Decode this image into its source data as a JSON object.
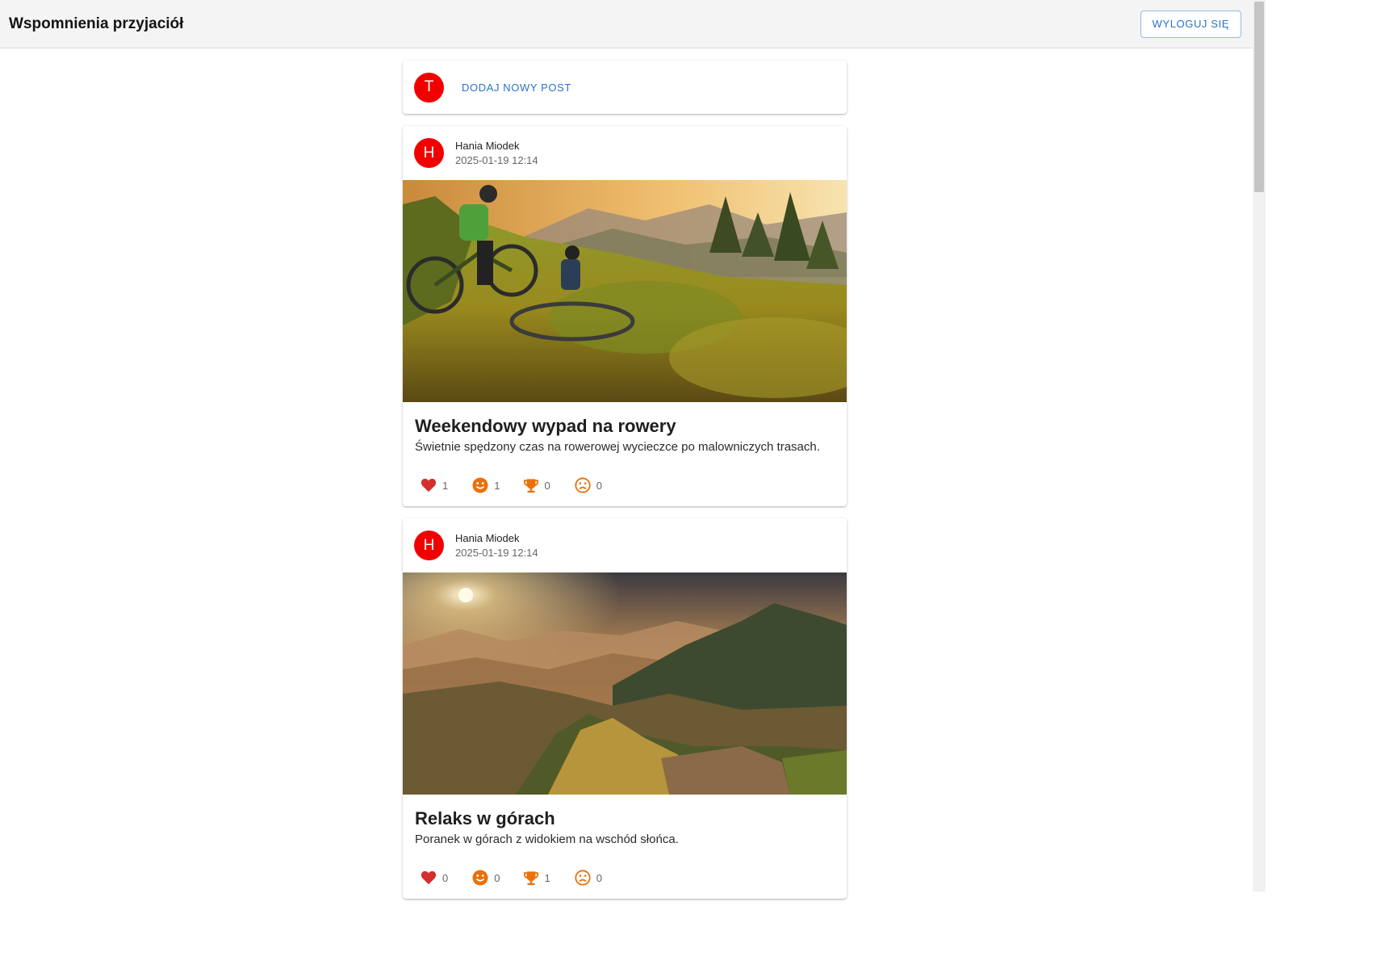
{
  "app": {
    "title": "Wspomnienia przyjaciół",
    "logout_label": "WYLOGUJ SIĘ"
  },
  "new_post": {
    "avatar_letter": "T",
    "button_label": "DODAJ NOWY POST"
  },
  "posts": [
    {
      "avatar_letter": "H",
      "author": "Hania Miodek",
      "date": "2025-01-19 12:14",
      "title": "Weekendowy wypad na rowery",
      "description": "Świetnie spędzony czas na rowerowej wycieczce po malowniczych trasach.",
      "reactions": {
        "heart": "1",
        "smile": "1",
        "trophy": "0",
        "sad": "0"
      }
    },
    {
      "avatar_letter": "H",
      "author": "Hania Miodek",
      "date": "2025-01-19 12:14",
      "title": "Relaks w górach",
      "description": "Poranek w górach z widokiem na wschód słońca.",
      "reactions": {
        "heart": "0",
        "smile": "0",
        "trophy": "1",
        "sad": "0"
      }
    }
  ],
  "icons": {
    "heart": "heart-icon",
    "smile": "smile-icon",
    "trophy": "trophy-icon",
    "sad": "sad-face-icon"
  },
  "colors": {
    "avatar": "#f20000",
    "accent": "#2a72c9",
    "heart": "#d32f2f",
    "orange": "#e8710a"
  }
}
